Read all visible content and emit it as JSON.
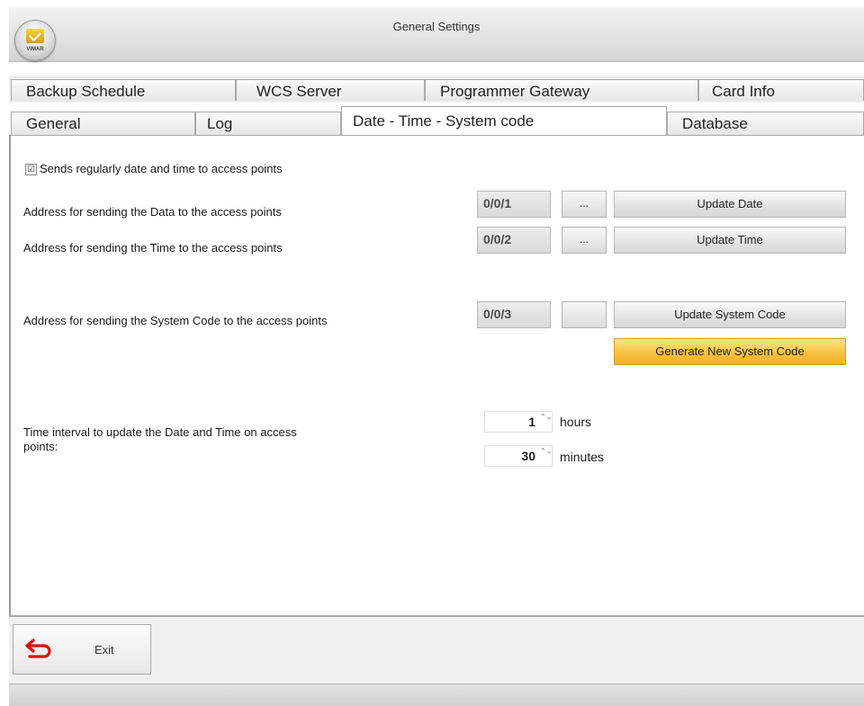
{
  "window": {
    "title": "General Settings",
    "logo_text": "VIMAR"
  },
  "tabs_row1": [
    {
      "label": "Backup Schedule"
    },
    {
      "label": "WCS Server"
    },
    {
      "label": "Programmer Gateway"
    },
    {
      "label": "Card Info"
    }
  ],
  "tabs_row2": [
    {
      "label": "General"
    },
    {
      "label": "Log"
    },
    {
      "label": "Date - Time - System code",
      "selected": true
    },
    {
      "label": "Database"
    }
  ],
  "panel": {
    "send_checkbox": {
      "label": "Sends regularly date and time to access points",
      "checked": true,
      "mark": "☑"
    },
    "date_row": {
      "label": "Address for sending the Data to the access points",
      "address": "0/0/1",
      "browse": "...",
      "button": "Update Date"
    },
    "time_row": {
      "label": "Address for sending the Time to the access points",
      "address": "0/0/2",
      "browse": "...",
      "button": "Update Time"
    },
    "syscode_row": {
      "label": "Address for sending the System Code to the access points",
      "address": "0/0/3",
      "browse": "",
      "button": "Update System Code",
      "generate_button": "Generate New System Code"
    },
    "interval": {
      "label_line1": "Time interval to update the Date and Time on access",
      "label_line2": "points:",
      "hours_value": "1",
      "hours_unit": "hours",
      "minutes_value": "30",
      "minutes_unit": "minutes",
      "spin_glyph": "⌃⌄"
    }
  },
  "bottom": {
    "exit_label": "Exit",
    "exit_icon": "return-arrow-icon"
  },
  "colors": {
    "accent_button": "#f7c242",
    "exit_icon": "#e01010"
  }
}
